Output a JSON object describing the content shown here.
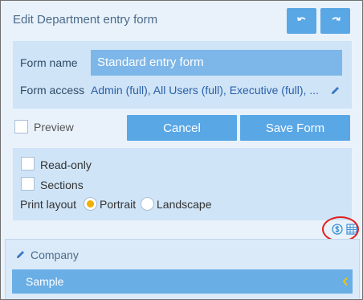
{
  "header": {
    "title": "Edit Department entry form",
    "undo_icon": "undo-icon",
    "redo_icon": "redo-icon"
  },
  "form": {
    "name_label": "Form name",
    "name_value": "Standard entry form",
    "access_label": "Form access",
    "access_value": "Admin (full), All Users (full), Executive (full), ...",
    "access_edit_icon": "pencil-icon"
  },
  "actions": {
    "preview_label": "Preview",
    "preview_checked": false,
    "cancel_label": "Cancel",
    "save_label": "Save Form"
  },
  "options": {
    "readonly_label": "Read-only",
    "readonly_checked": false,
    "sections_label": "Sections",
    "sections_checked": false,
    "print_layout_label": "Print layout",
    "portrait_label": "Portrait",
    "landscape_label": "Landscape",
    "print_layout_selected": "Portrait"
  },
  "tools": {
    "icons": [
      "dollar-circle-icon",
      "grid-icon"
    ]
  },
  "section": {
    "title": "Company",
    "title_icon": "pencil-icon",
    "field_label": "Sample",
    "chevron_icon": "chevron-left-icon"
  },
  "colors": {
    "accent": "#5aa7e6",
    "panel": "#cfe4f7",
    "radio_selected": "#f0b000",
    "highlight_ring": "#e02020"
  }
}
